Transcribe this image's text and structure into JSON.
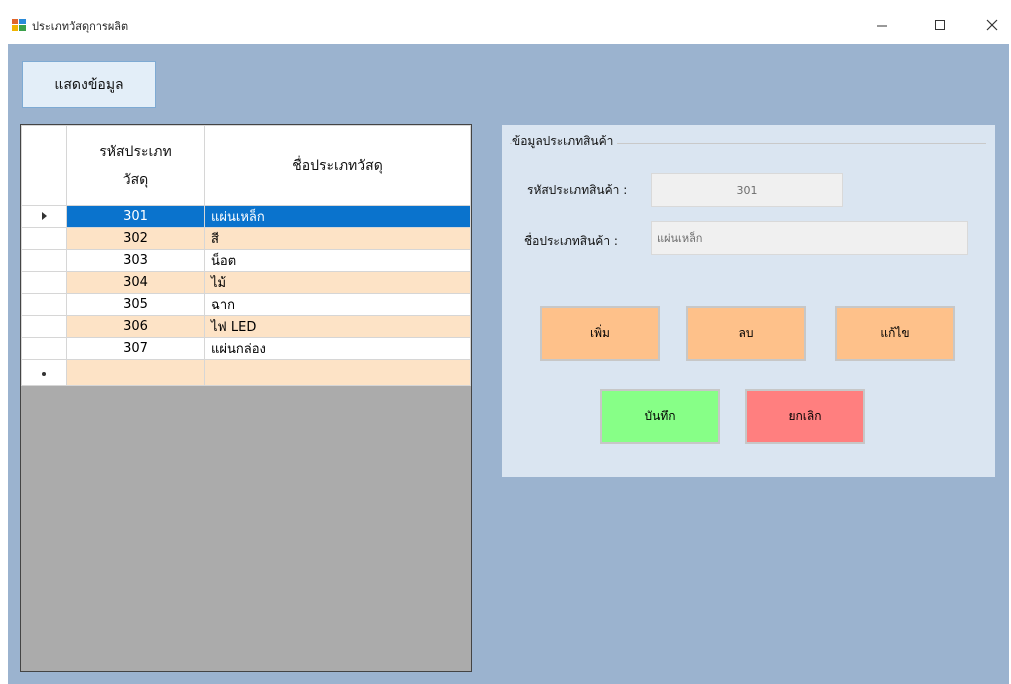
{
  "window": {
    "title": "ประเภทวัสดุการผลิต"
  },
  "toolbar": {
    "show_data_label": "แสดงข้อมูล"
  },
  "grid": {
    "columns": [
      "รหัสประเภท\nวัสดุ",
      "ชื่อประเภทวัสดุ"
    ],
    "rows": [
      {
        "code": "301",
        "name": "แผ่นเหล็ก"
      },
      {
        "code": "302",
        "name": "สี"
      },
      {
        "code": "303",
        "name": "น็อต"
      },
      {
        "code": "304",
        "name": "ไม้"
      },
      {
        "code": "305",
        "name": "ฉาก"
      },
      {
        "code": "306",
        "name": "ไฟ LED"
      },
      {
        "code": "307",
        "name": "แผ่นกล่อง"
      }
    ],
    "selected_index": 0
  },
  "detail": {
    "group_title": "ข้อมูลประเภทสินค้า",
    "code_label": "รหัสประเภทสินค้า :",
    "code_value": "301",
    "name_label": "ชื่อประเภทสินค้า :",
    "name_value": "แผ่นเหล็ก"
  },
  "actions": {
    "add_label": "เพิ่ม",
    "delete_label": "ลบ",
    "edit_label": "แก้ไข",
    "save_label": "บันทึก",
    "cancel_label": "ยกเลิก"
  },
  "colors": {
    "client_bg": "#9bb3cf",
    "selection": "#0a73cd",
    "alt_row": "#fde3c6",
    "orange_button": "#fec18a",
    "save_button": "#87ff87",
    "cancel_button": "#ff7f7f"
  }
}
